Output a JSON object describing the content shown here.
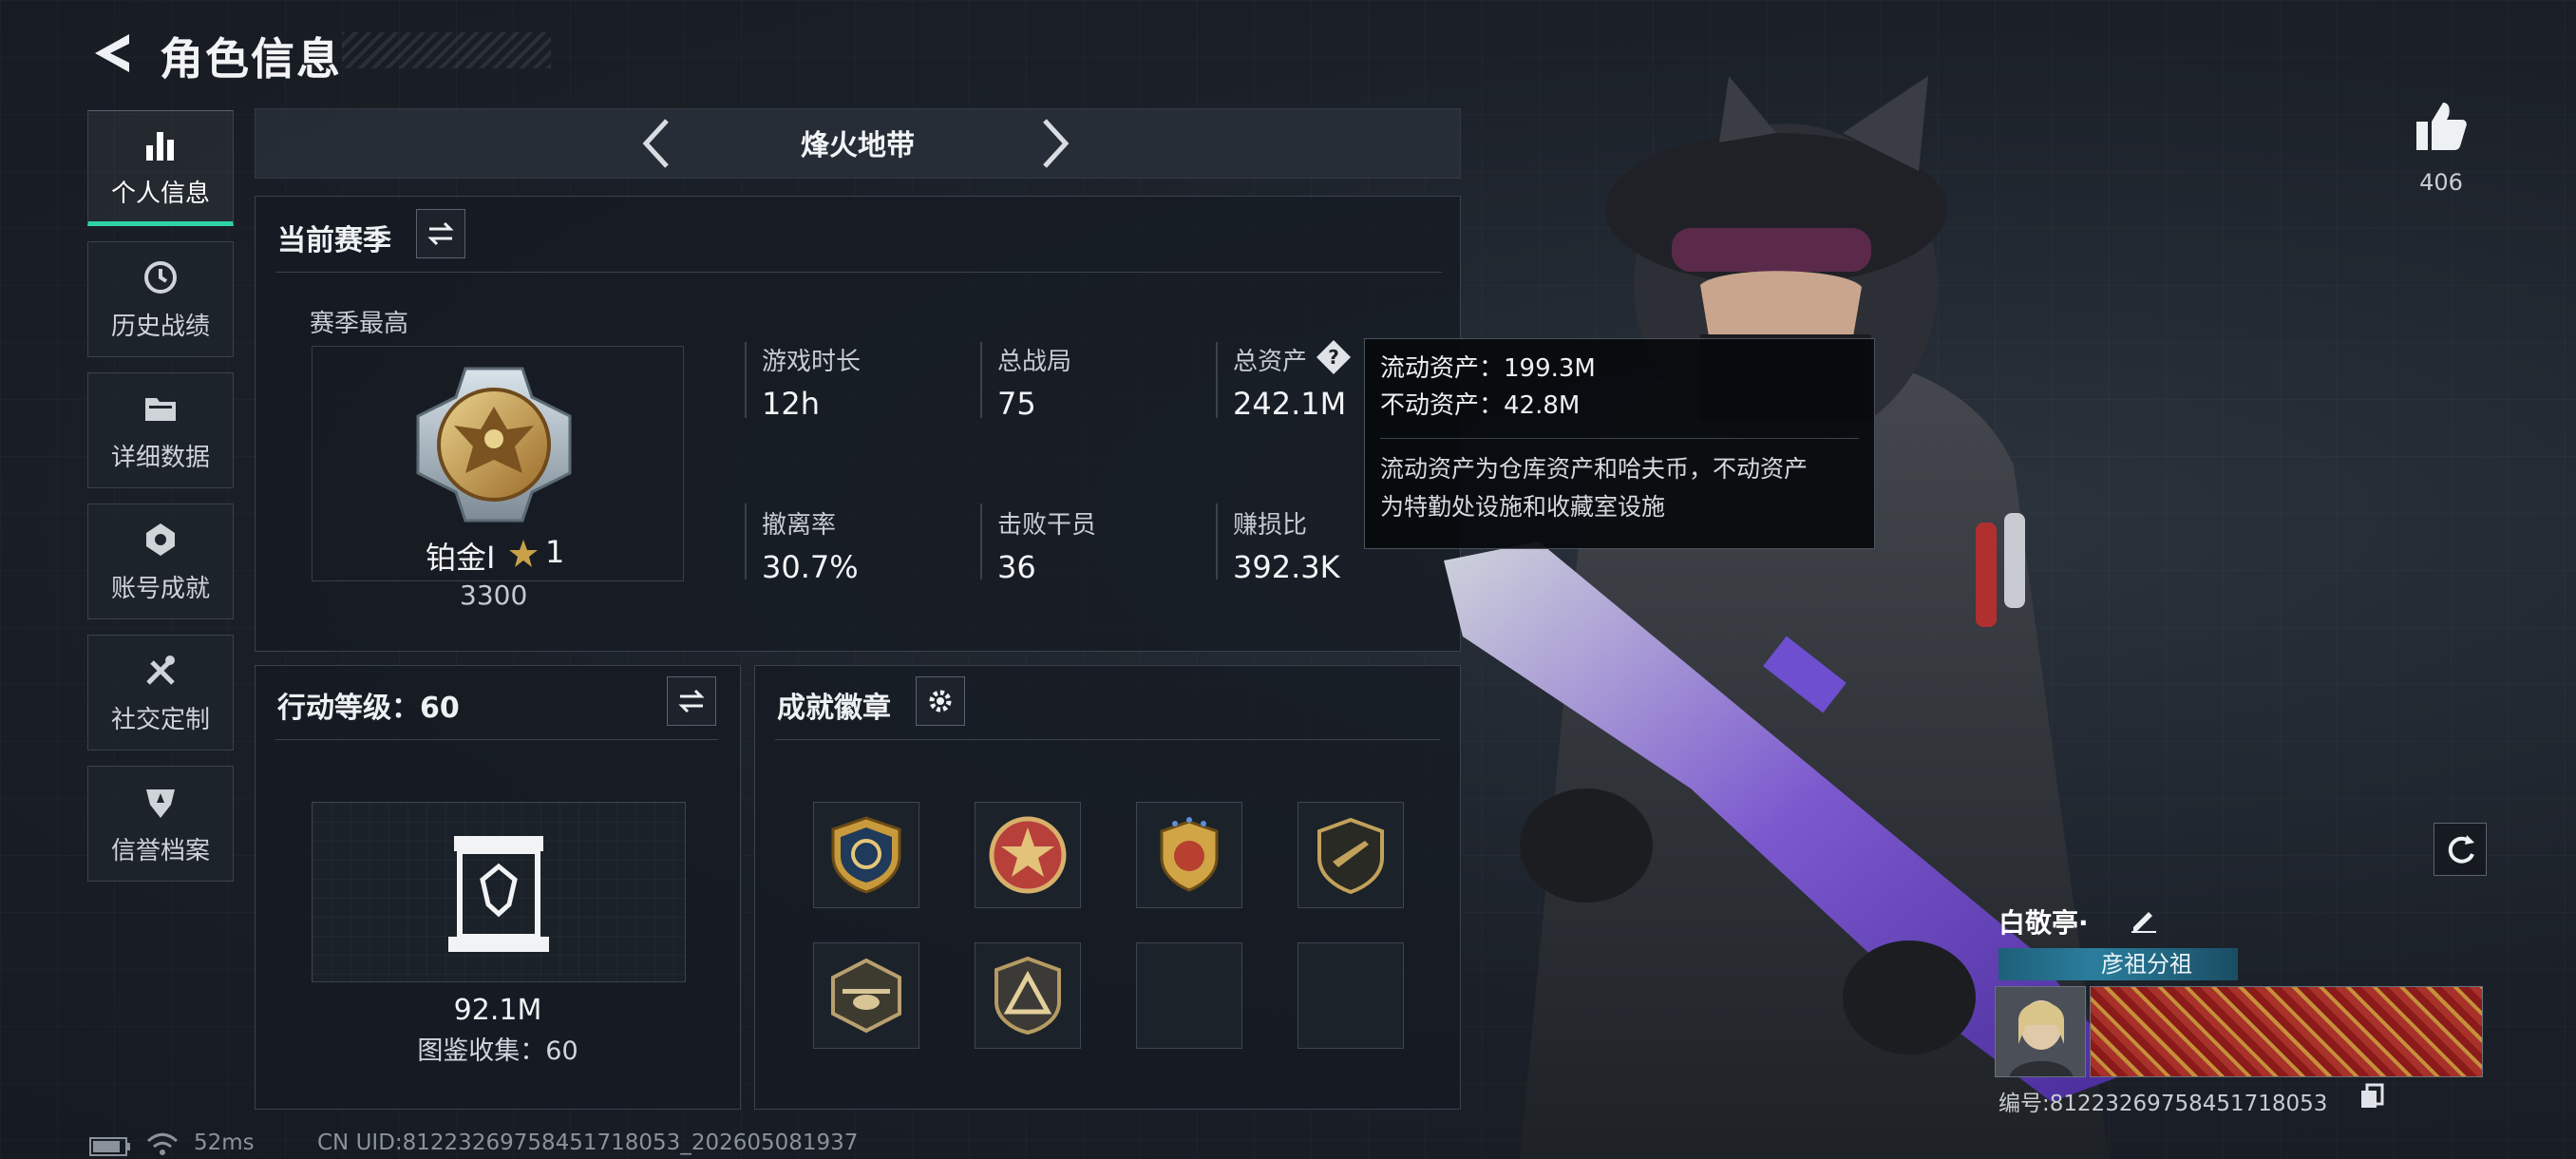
{
  "header": {
    "title": "角色信息"
  },
  "sidebar": {
    "items": [
      {
        "label": "个人信息",
        "icon": "bar-chart-icon",
        "active": true
      },
      {
        "label": "历史战绩",
        "icon": "history-icon",
        "active": false
      },
      {
        "label": "详细数据",
        "icon": "folder-icon",
        "active": false
      },
      {
        "label": "账号成就",
        "icon": "achievement-icon",
        "active": false
      },
      {
        "label": "社交定制",
        "icon": "tools-icon",
        "active": false
      },
      {
        "label": "信誉档案",
        "icon": "credit-shield-icon",
        "active": false
      }
    ]
  },
  "mode": {
    "name": "烽火地带"
  },
  "season": {
    "title": "当前赛季",
    "best_label": "赛季最高",
    "rank_name": "铂金Ⅰ",
    "rank_stars": "1",
    "rank_score": "3300",
    "stats": [
      {
        "label": "游戏时长",
        "value": "12h"
      },
      {
        "label": "总战局",
        "value": "75"
      },
      {
        "label": "总资产",
        "value": "242.1M"
      },
      {
        "label": "撤离率",
        "value": "30.7%"
      },
      {
        "label": "击败干员",
        "value": "36"
      },
      {
        "label": "赚损比",
        "value": "392.3K"
      }
    ]
  },
  "tooltip": {
    "liquid": "流动资产：199.3M",
    "fixed": "不动资产：42.8M",
    "desc_line1": "流动资产为仓库资产和哈夫币，不动资产",
    "desc_line2": "为特勤处设施和收藏室设施"
  },
  "action_level": {
    "title": "行动等级：60",
    "collection_value": "92.1M",
    "collection_label": "图鉴收集：60"
  },
  "achievements": {
    "title": "成就徽章",
    "badges": [
      "badge-1",
      "badge-2",
      "badge-3",
      "badge-4",
      "badge-5",
      "badge-6",
      "",
      ""
    ]
  },
  "profile": {
    "likes": "406",
    "name": "白敬亭·",
    "guild": "彦祖分祖",
    "id": "编号:8122326975845171805​3"
  },
  "status": {
    "ping": "52ms",
    "uid": "CN UID:8122326975845171805​3_202605081937"
  },
  "colors": {
    "accent": "#2ed3a6",
    "gold": "#c9a04a"
  }
}
